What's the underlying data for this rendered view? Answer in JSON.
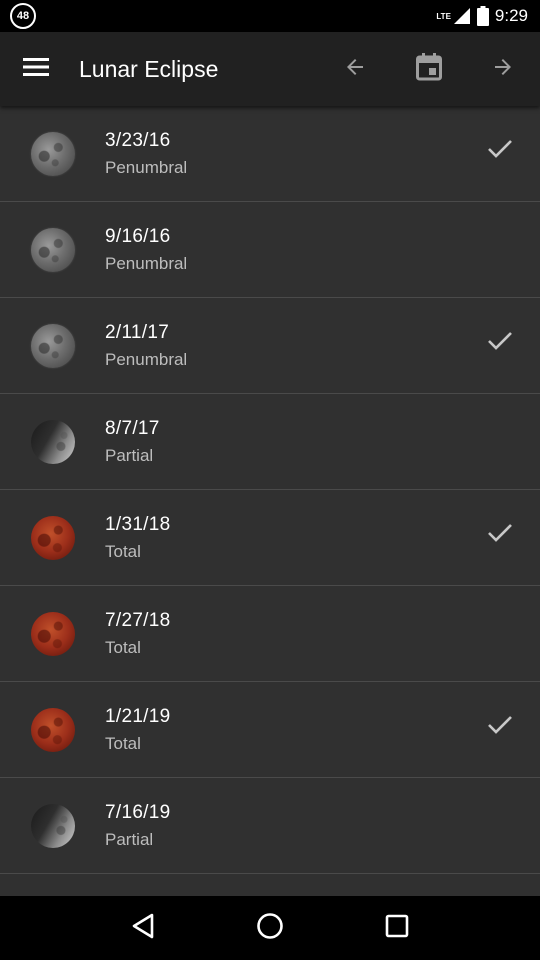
{
  "status_bar": {
    "notification_badge": "48",
    "network": "LTE",
    "time": "9:29",
    "icons": [
      "signal-icon",
      "battery-icon"
    ]
  },
  "app_bar": {
    "title": "Lunar Eclipse",
    "icons": [
      "menu-icon",
      "arrow-back-icon",
      "calendar-icon",
      "arrow-forward-icon"
    ]
  },
  "eclipses": [
    {
      "date": "3/23/16",
      "type": "Penumbral",
      "checked": true
    },
    {
      "date": "9/16/16",
      "type": "Penumbral",
      "checked": false
    },
    {
      "date": "2/11/17",
      "type": "Penumbral",
      "checked": true
    },
    {
      "date": "8/7/17",
      "type": "Partial",
      "checked": false
    },
    {
      "date": "1/31/18",
      "type": "Total",
      "checked": true
    },
    {
      "date": "7/27/18",
      "type": "Total",
      "checked": false
    },
    {
      "date": "1/21/19",
      "type": "Total",
      "checked": true
    },
    {
      "date": "7/16/19",
      "type": "Partial",
      "checked": false
    }
  ],
  "nav_bar": {
    "icons": [
      "back-triangle-icon",
      "home-circle-icon",
      "recents-square-icon"
    ]
  },
  "colors": {
    "app_bar": "#212121",
    "background": "#303030",
    "secondary_text": "#bdbdbd",
    "divider": "#4a4a4a"
  }
}
